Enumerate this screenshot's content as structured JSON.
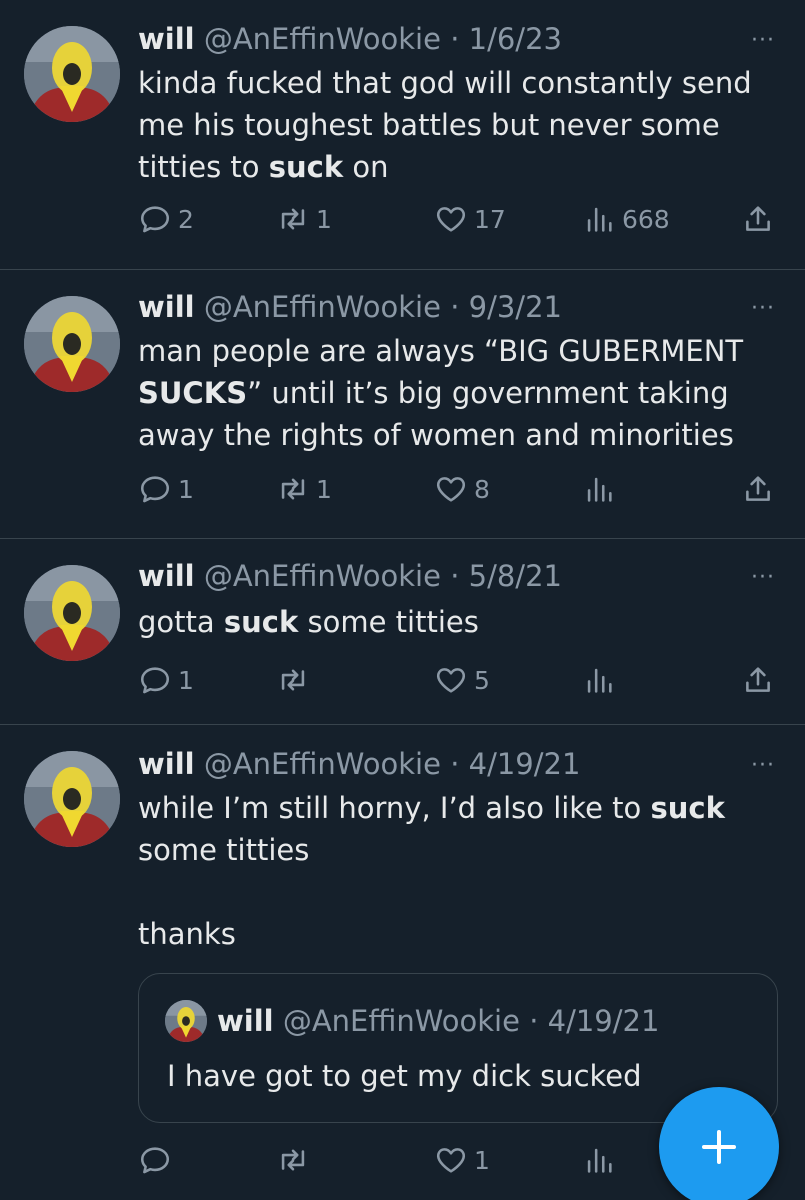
{
  "colors": {
    "background": "#15202b",
    "divider": "#38444d",
    "muted": "#8b98a5",
    "text": "#e7e9ea",
    "accent": "#1d9bf0"
  },
  "more_icon": "···",
  "tweets": [
    {
      "name": "will",
      "handle": "@AnEffinWookie",
      "date": "1/6/23",
      "text_parts": [
        "kinda fucked that god will constantly send me his toughest battles but never some titties to ",
        "suck",
        " on"
      ],
      "replies": "2",
      "retweets": "1",
      "likes": "17",
      "views": "668"
    },
    {
      "name": "will",
      "handle": "@AnEffinWookie",
      "date": "9/3/21",
      "text_parts": [
        "man people are always “BIG GUBERMENT ",
        "SUCKS",
        "” until it’s big government taking away the rights of women and minorities"
      ],
      "replies": "1",
      "retweets": "1",
      "likes": "8",
      "views": ""
    },
    {
      "name": "will",
      "handle": "@AnEffinWookie",
      "date": "5/8/21",
      "text_parts": [
        "gotta ",
        "suck",
        " some titties"
      ],
      "replies": "1",
      "retweets": "",
      "likes": "5",
      "views": ""
    },
    {
      "name": "will",
      "handle": "@AnEffinWookie",
      "date": "4/19/21",
      "text_parts": [
        "while I’m still horny, I’d also like to ",
        "suck",
        " some titties\n\nthanks"
      ],
      "replies": "",
      "retweets": "",
      "likes": "1",
      "views": "",
      "quote": {
        "name": "will",
        "handle": "@AnEffinWookie",
        "date": "4/19/21",
        "text": "I have got to get my dick sucked"
      }
    }
  ],
  "separator": "·",
  "fab_icon": "plus-icon"
}
